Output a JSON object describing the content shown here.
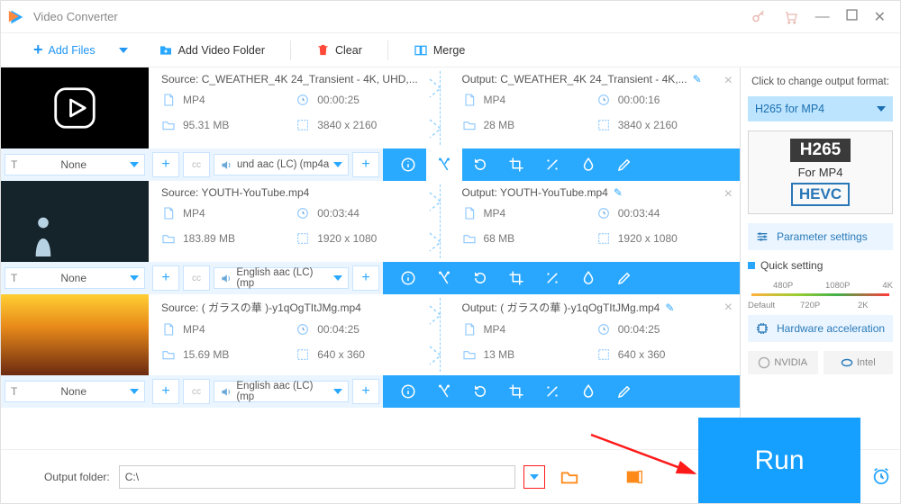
{
  "app": {
    "title": "Video Converter"
  },
  "toolbar": {
    "add_files": "Add Files",
    "add_folder": "Add Video Folder",
    "clear": "Clear",
    "merge": "Merge"
  },
  "subtitle_none": "None",
  "files": [
    {
      "source_label": "Source: C_WEATHER_4K 24_Transient - 4K, UHD,...",
      "src": {
        "format": "MP4",
        "duration": "00:00:25",
        "size": "95.31 MB",
        "res": "3840 x 2160"
      },
      "output_label": "Output: C_WEATHER_4K 24_Transient - 4K,...",
      "out": {
        "format": "MP4",
        "duration": "00:00:16",
        "size": "28 MB",
        "res": "3840 x 2160"
      },
      "audio": "und aac (LC) (mp4a"
    },
    {
      "source_label": "Source: YOUTH-YouTube.mp4",
      "src": {
        "format": "MP4",
        "duration": "00:03:44",
        "size": "183.89 MB",
        "res": "1920 x 1080"
      },
      "output_label": "Output: YOUTH-YouTube.mp4",
      "out": {
        "format": "MP4",
        "duration": "00:03:44",
        "size": "68 MB",
        "res": "1920 x 1080"
      },
      "audio": "English aac (LC) (mp"
    },
    {
      "source_label": "Source: ( ガラスの華 )-y1qOgTItJMg.mp4",
      "src": {
        "format": "MP4",
        "duration": "00:04:25",
        "size": "15.69 MB",
        "res": "640 x 360"
      },
      "output_label": "Output: ( ガラスの華 )-y1qOgTItJMg.mp4",
      "out": {
        "format": "MP4",
        "duration": "00:04:25",
        "size": "13 MB",
        "res": "640 x 360"
      },
      "audio": "English aac (LC) (mp"
    }
  ],
  "sidebar": {
    "change_label": "Click to change output format:",
    "format_name": "H265 for MP4",
    "card_top": "H265",
    "card_mid": "For MP4",
    "card_bot": "HEVC",
    "param_settings": "Parameter settings",
    "quick_setting": "Quick setting",
    "scale": {
      "p480": "480P",
      "p720": "720P",
      "p1080": "1080P",
      "p2k": "2K",
      "p4k": "4K",
      "default": "Default"
    },
    "hw_accel": "Hardware acceleration",
    "nvidia": "NVIDIA",
    "intel": "Intel"
  },
  "footer": {
    "output_label": "Output folder:",
    "output_path": "C:\\",
    "run": "Run"
  }
}
